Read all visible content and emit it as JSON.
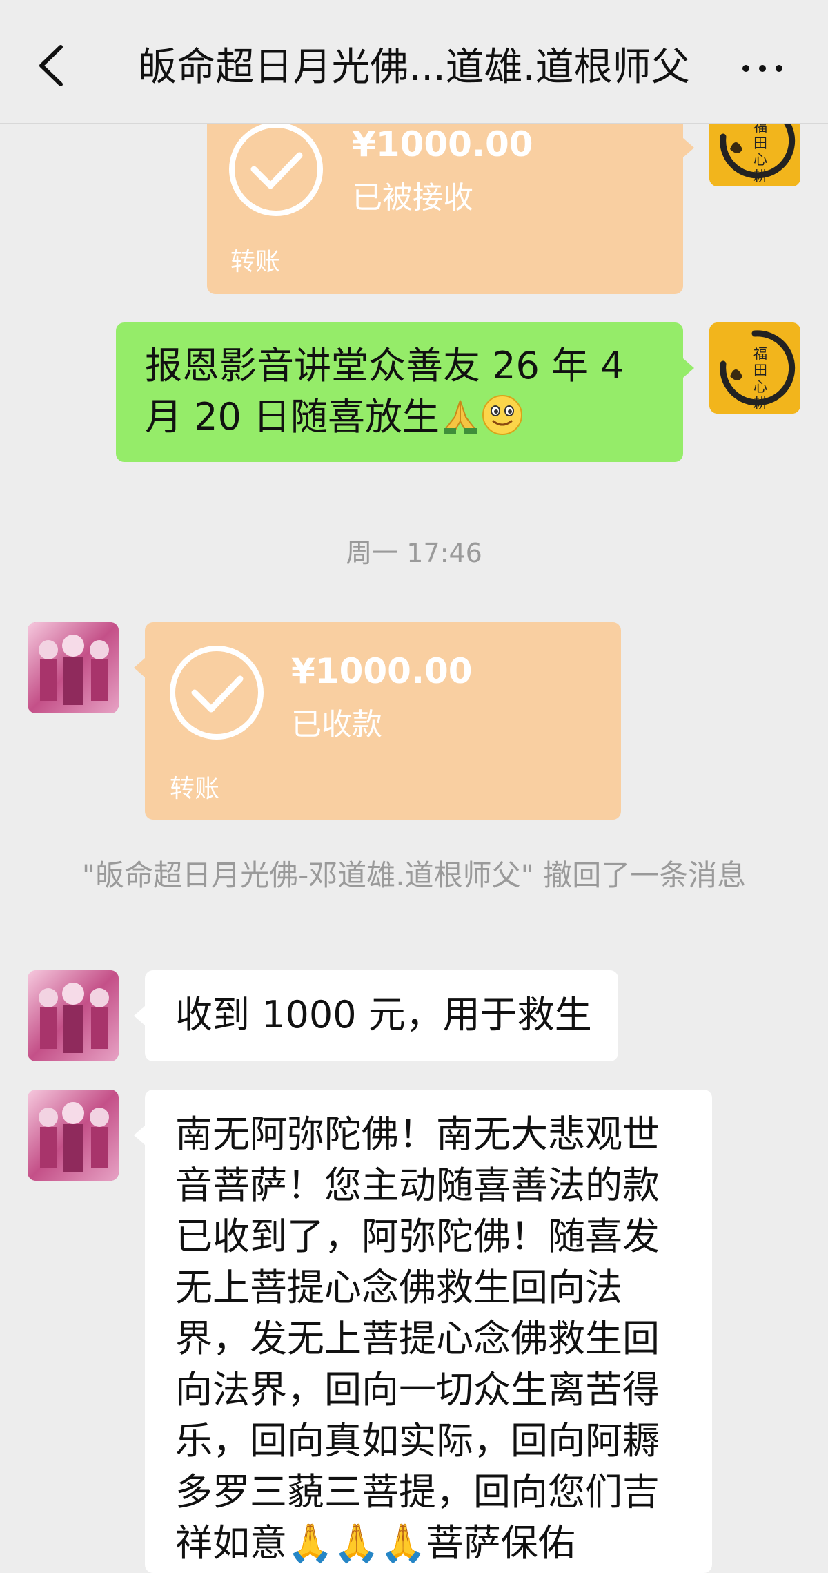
{
  "header": {
    "title": "皈命超日月光佛...道雄.道根师父"
  },
  "messages": {
    "transfer_1": {
      "amount": "¥1000.00",
      "status": "已被接收",
      "label": "转账"
    },
    "text_1": {
      "text": "报恩影音讲堂众善友 26 年 4 月 20 日随喜放生",
      "emoji": [
        "folded-hands",
        "smiling-face"
      ]
    },
    "timestamp": "周一 17:46",
    "transfer_2": {
      "amount": "¥1000.00",
      "status": "已收款",
      "label": "转账"
    },
    "recall_notice": "\"皈命超日月光佛-邓道雄.道根师父\" 撤回了一条消息",
    "text_2": {
      "text": "收到 1000 元，用于救生"
    },
    "text_3": {
      "text": "南无阿弥陀佛！南无大悲观世音菩萨！您主动随喜善法的款已收到了，阿弥陀佛！随喜发无上菩提心念佛救生回向法界，发无上菩提心念佛救生回向法界，回向一切众生离苦得乐，回向真如实际，回向阿耨多罗三藐三菩提，回向您们吉祥如意🙏🙏🙏菩萨保佑"
    }
  },
  "avatars": {
    "self_text": "福田心耕"
  },
  "colors": {
    "background": "#ededed",
    "transfer_card": "#f9cfa1",
    "bubble_self": "#95ec69",
    "bubble_peer": "#ffffff",
    "system_text": "#9a9a9a"
  }
}
